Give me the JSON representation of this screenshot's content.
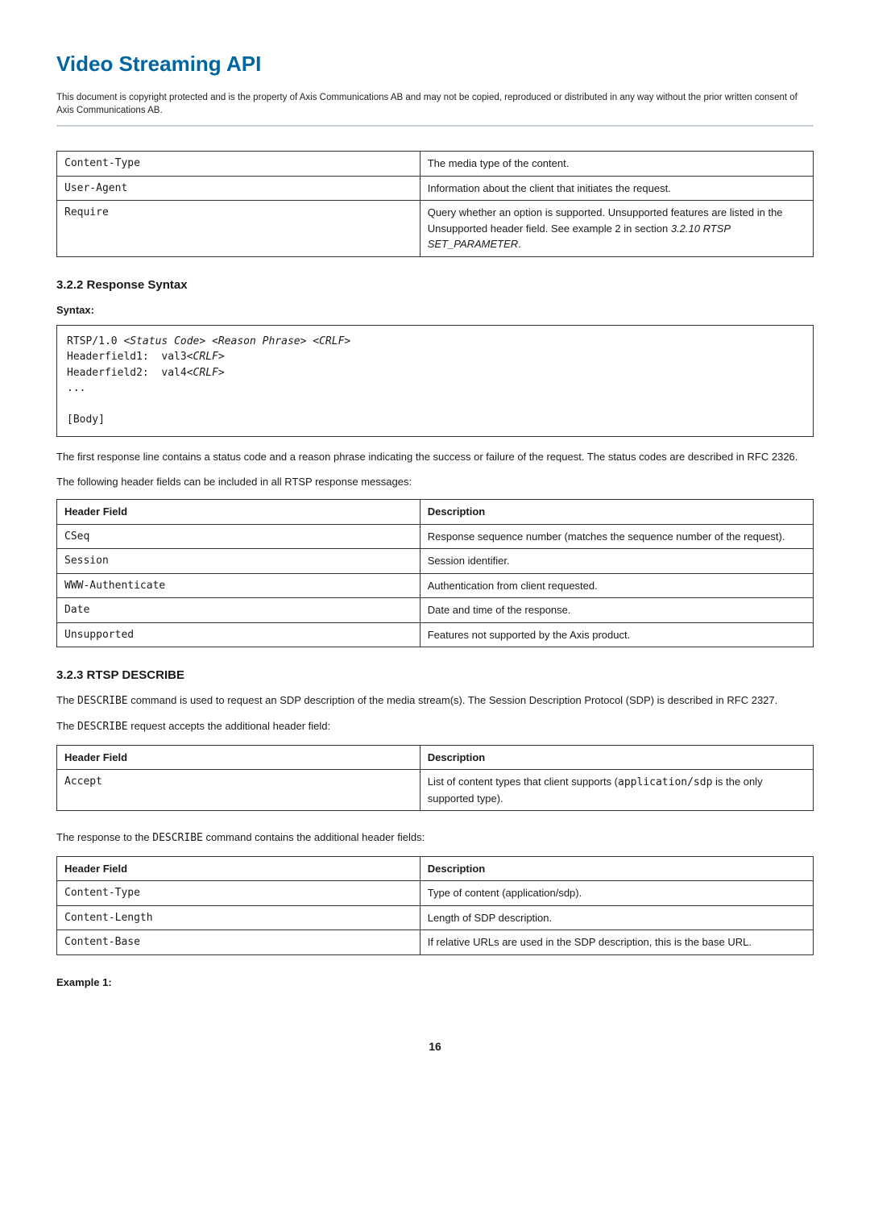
{
  "header": {
    "title": "Video Streaming API",
    "copyright": "This document is copyright protected and is the property of Axis Communications AB and may not be copied, reproduced or distributed in any way without the prior written consent of Axis Communications AB."
  },
  "table_request_headers": {
    "rows": [
      {
        "field": "Content-Type",
        "desc": "The media type of the content."
      },
      {
        "field": "User-Agent",
        "desc": "Information about the client that initiates the request."
      },
      {
        "field": "Require",
        "desc_plain": "Query whether an option is supported. Unsupported features are listed in the Unsupported header field. See example 2 in section ",
        "desc_em": "3.2.10 RTSP SET_PARAMETER",
        "desc_tail": "."
      }
    ]
  },
  "section_322": {
    "heading": "3.2.2   Response Syntax",
    "syntax_label": "Syntax:",
    "code_line1_a": "RTSP/1.0 <",
    "code_line1_b": "Status Code",
    "code_line1_c": "> <",
    "code_line1_d": "Reason Phrase",
    "code_line1_e": "> <",
    "code_line1_f": "CRLF",
    "code_line1_g": ">",
    "code_line2_a": "Headerfield1:  val3<",
    "code_line2_b": "CRLF",
    "code_line2_c": ">",
    "code_line3_a": "Headerfield2:  val4<",
    "code_line3_b": "CRLF",
    "code_line3_c": ">",
    "code_line4": "...",
    "code_line5": "",
    "code_line6": "[Body]",
    "para1": "The first response line contains a status code and a reason phrase indicating the success or failure of the request. The status codes are described in RFC 2326.",
    "para2": "The following header fields can be included in all RTSP response messages:",
    "table_header_field": "Header Field",
    "table_header_desc": "Description",
    "rows": [
      {
        "field": "CSeq",
        "desc": "Response sequence number (matches the sequence number of the request)."
      },
      {
        "field": "Session",
        "desc": "Session identifier."
      },
      {
        "field": "WWW-Authenticate",
        "desc": "Authentication from client requested."
      },
      {
        "field": "Date",
        "desc": "Date and time of the response."
      },
      {
        "field": "Unsupported",
        "desc": "Features not supported by the Axis product."
      }
    ]
  },
  "section_323": {
    "heading": "3.2.3   RTSP DESCRIBE",
    "para1_a": "The ",
    "para1_b": "DESCRIBE",
    "para1_c": " command is used to request an SDP description of the media stream(s). The Session Description Protocol (SDP) is described in RFC 2327.",
    "para2_a": "The ",
    "para2_b": "DESCRIBE",
    "para2_c": " request accepts the additional header field:",
    "table1_header_field": "Header Field",
    "table1_header_desc": "Description",
    "table1_rows": [
      {
        "field": "Accept",
        "desc_a": "List of content types that client supports (",
        "desc_b": "application/sdp",
        "desc_c": " is the only supported type)."
      }
    ],
    "para3_a": "The response to the ",
    "para3_b": "DESCRIBE",
    "para3_c": " command contains the additional header fields:",
    "table2_header_field": "Header Field",
    "table2_header_desc": "Description",
    "table2_rows": [
      {
        "field": "Content-Type",
        "desc": "Type of content (application/sdp)."
      },
      {
        "field": "Content-Length",
        "desc": "Length of SDP description."
      },
      {
        "field": "Content-Base",
        "desc": "If relative URLs are used in the SDP description, this is the base URL."
      }
    ],
    "example_label": "Example 1:"
  },
  "page_number": "16"
}
